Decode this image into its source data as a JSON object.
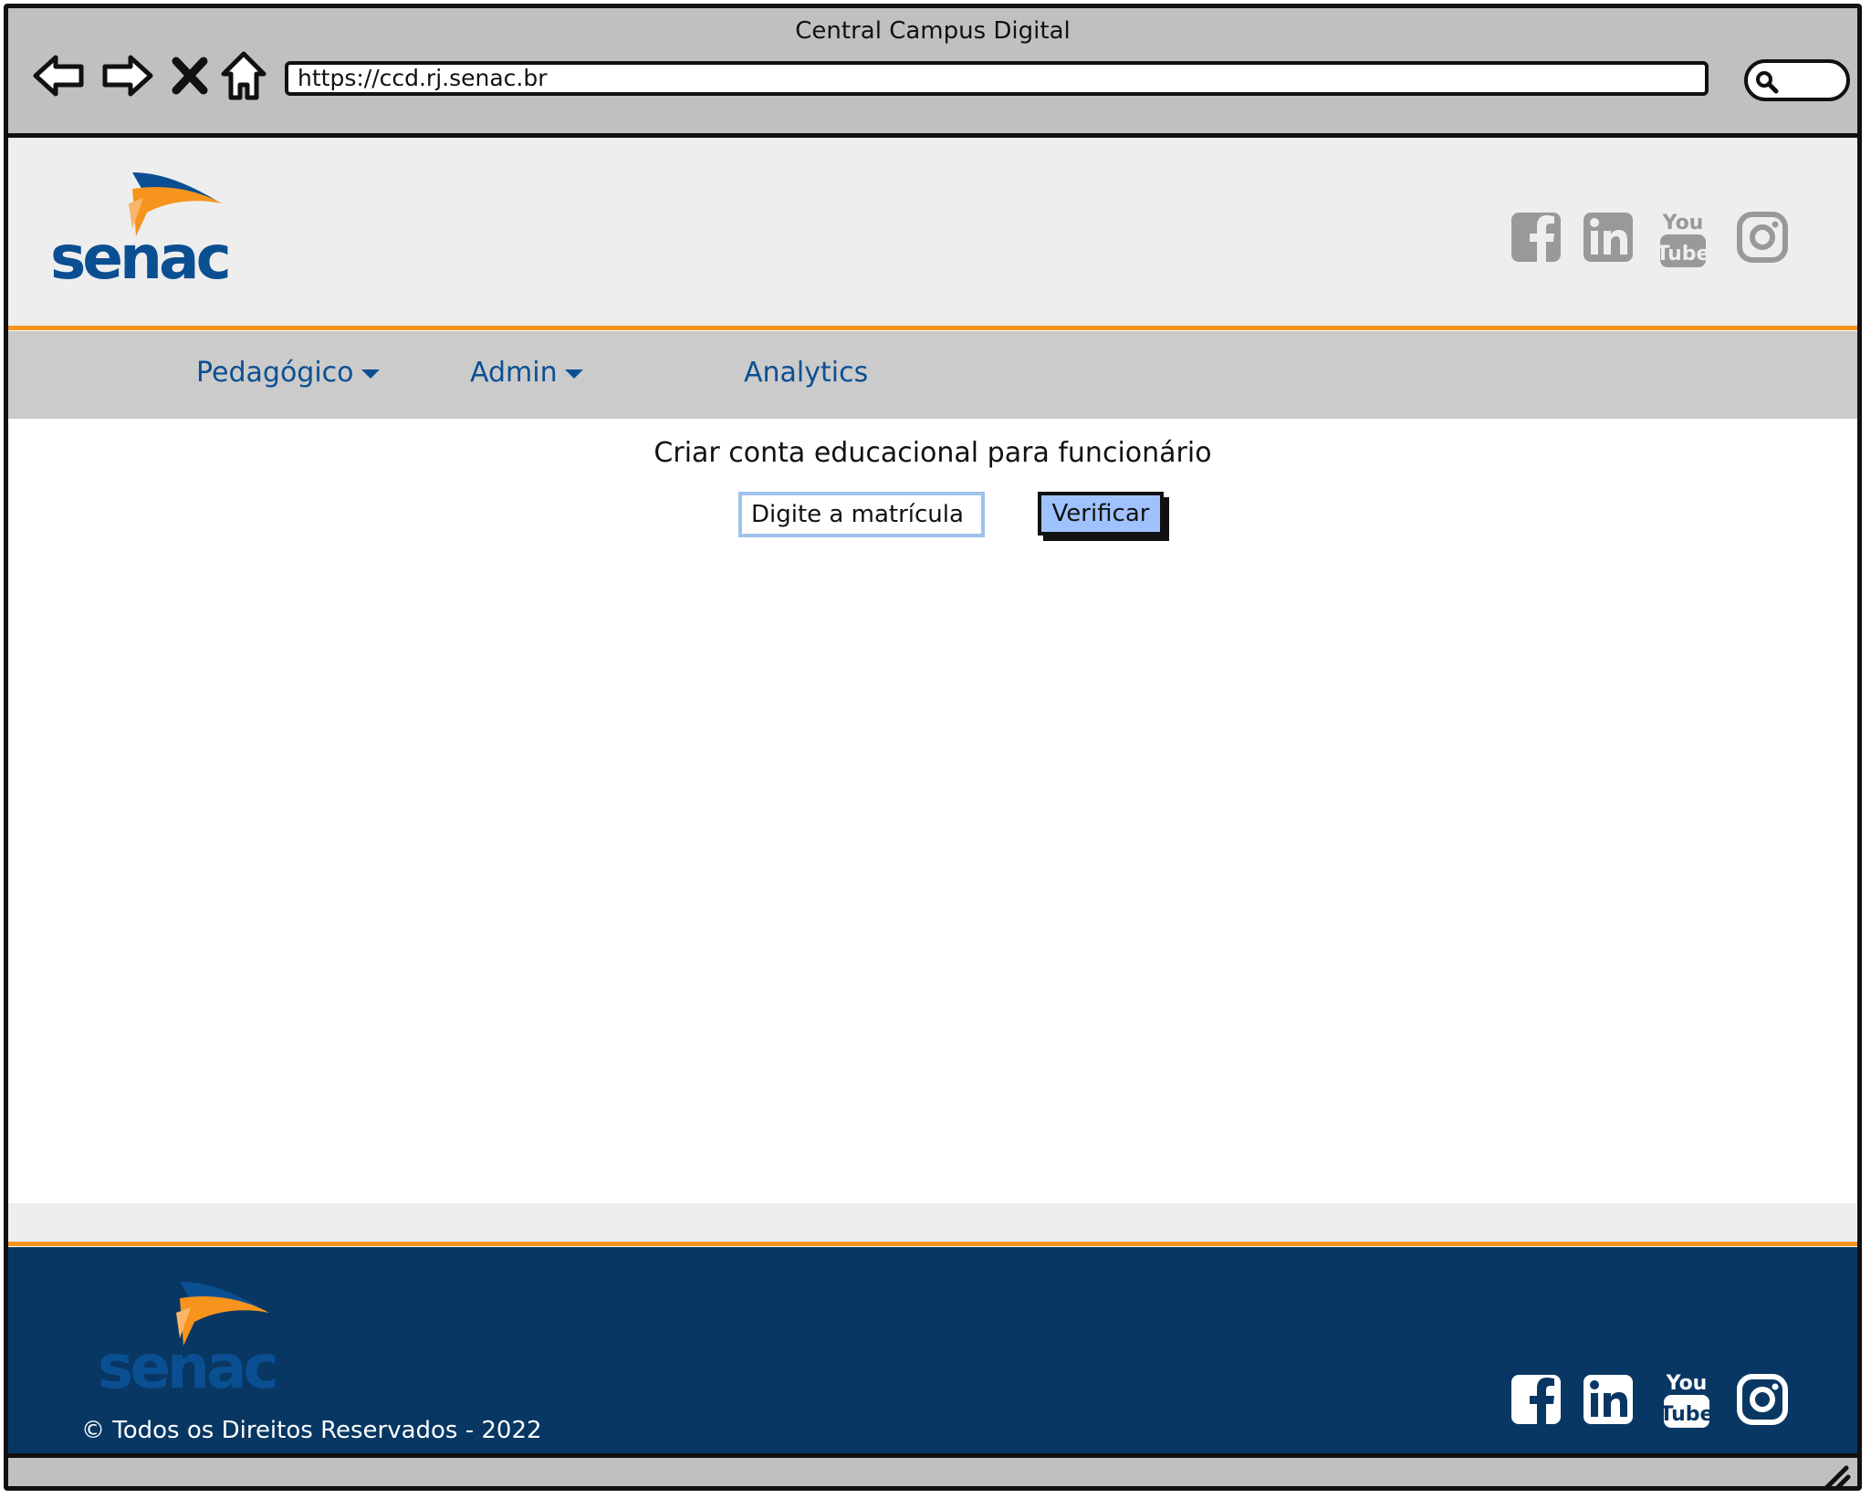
{
  "browser": {
    "window_title": "Central Campus Digital",
    "url": "https://ccd.rj.senac.br"
  },
  "header": {
    "logo_text": "senac",
    "social": [
      "facebook-icon",
      "linkedin-icon",
      "youtube-icon",
      "instagram-icon"
    ]
  },
  "nav": {
    "items": [
      {
        "label": "Pedagógico",
        "dropdown": true
      },
      {
        "label": "Admin",
        "dropdown": true
      },
      {
        "label": "Analytics",
        "dropdown": false
      }
    ]
  },
  "main": {
    "title": "Criar conta educacional para funcionário",
    "matricula_value": "Digite a matrícula",
    "verify_label": "Verificar"
  },
  "footer": {
    "copyright": "© Todos os Direitos Reservados - 2022"
  },
  "colors": {
    "brand_blue": "#0b4f93",
    "brand_orange": "#f7941d",
    "footer_bg": "#083763",
    "header_bg": "#eeeeee",
    "menu_bg": "#cbcbcb",
    "button_bg": "#9fc2ff"
  }
}
